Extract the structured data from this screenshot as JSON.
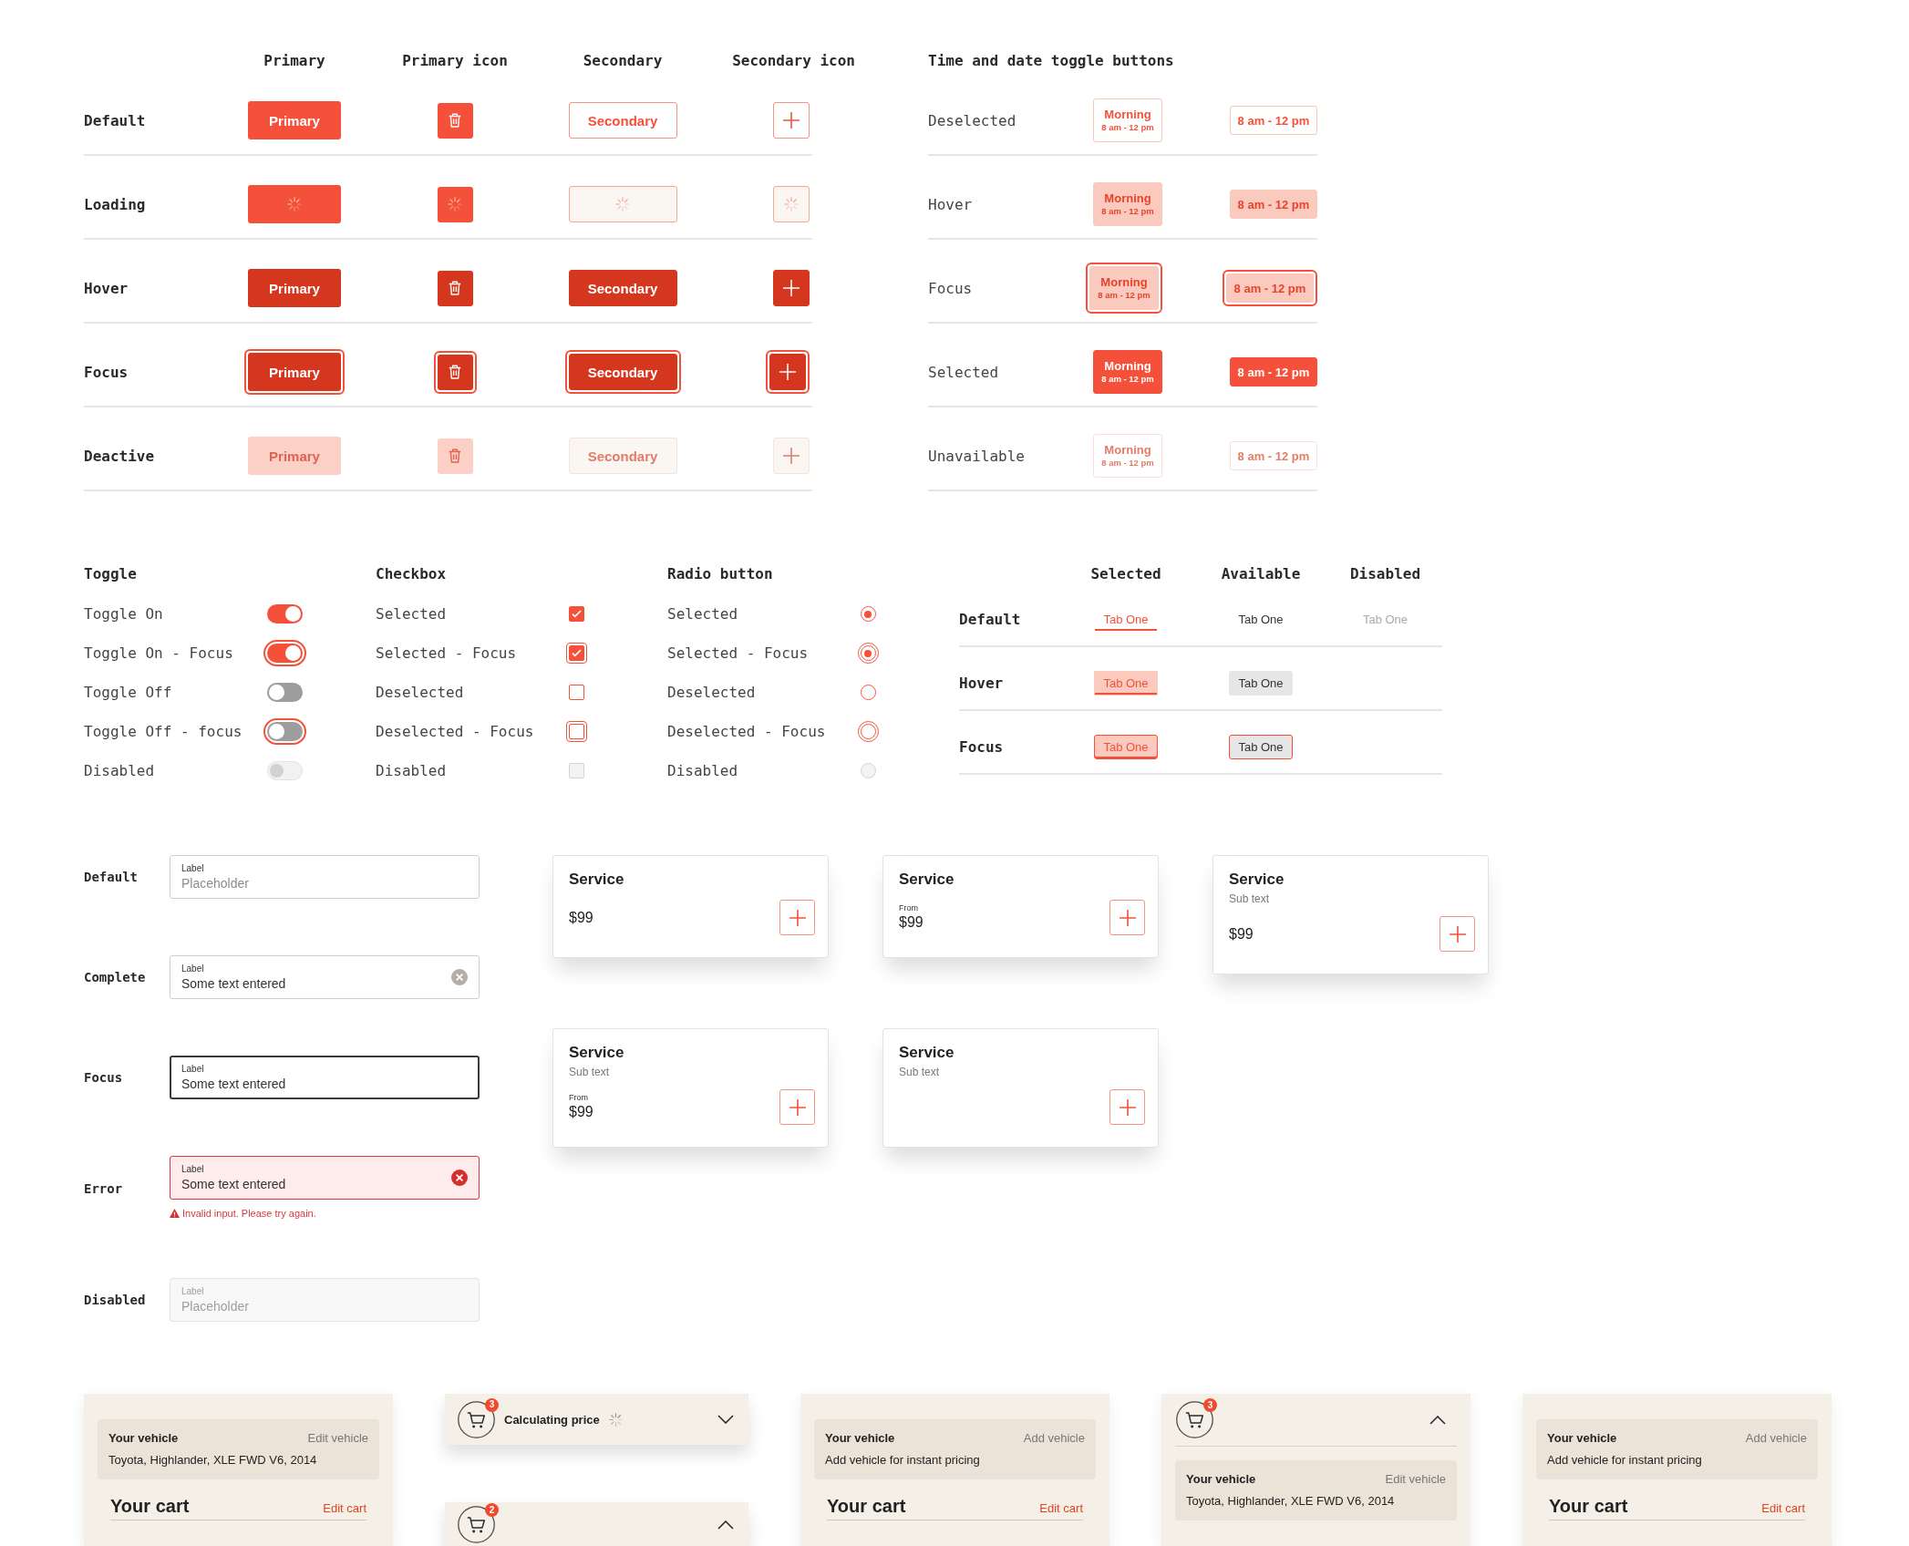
{
  "button_states": {
    "columns": [
      "Primary",
      "Primary icon",
      "Secondary",
      "Secondary icon"
    ],
    "rows": [
      {
        "label": "Default",
        "kind": "default",
        "primary": "Primary",
        "secondary": "Secondary"
      },
      {
        "label": "Loading",
        "kind": "loading"
      },
      {
        "label": "Hover",
        "kind": "hover",
        "primary": "Primary",
        "secondary": "Secondary"
      },
      {
        "label": "Focus",
        "kind": "focus",
        "primary": "Primary",
        "secondary": "Secondary"
      },
      {
        "label": "Deactive",
        "kind": "disabled",
        "primary": "Primary",
        "secondary": "Secondary"
      }
    ]
  },
  "time_toggles": {
    "title": "Time and date toggle buttons",
    "rows": [
      {
        "label": "Deselected",
        "kind": "deselected",
        "slot_title": "Morning",
        "slot_time": "8 am - 12 pm",
        "range": "8 am - 12 pm"
      },
      {
        "label": "Hover",
        "kind": "hover",
        "slot_title": "Morning",
        "slot_time": "8 am - 12 pm",
        "range": "8 am - 12 pm"
      },
      {
        "label": "Focus",
        "kind": "focus",
        "slot_title": "Morning",
        "slot_time": "8 am - 12 pm",
        "range": "8 am - 12 pm"
      },
      {
        "label": "Selected",
        "kind": "selected",
        "slot_title": "Morning",
        "slot_time": "8 am - 12 pm",
        "range": "8 am - 12 pm"
      },
      {
        "label": "Unavailable",
        "kind": "unavailable",
        "slot_title": "Morning",
        "slot_time": "8 am - 12 pm",
        "range": "8 am - 12 pm"
      }
    ]
  },
  "toggles": {
    "title": "Toggle",
    "items": [
      {
        "label": "Toggle On",
        "on": true,
        "focus": false,
        "disabled": false
      },
      {
        "label": "Toggle On - Focus",
        "on": true,
        "focus": true,
        "disabled": false
      },
      {
        "label": "Toggle Off",
        "on": false,
        "focus": false,
        "disabled": false
      },
      {
        "label": "Toggle Off - focus",
        "on": false,
        "focus": true,
        "disabled": false
      },
      {
        "label": "Disabled",
        "on": false,
        "focus": false,
        "disabled": true
      }
    ]
  },
  "checkboxes": {
    "title": "Checkbox",
    "items": [
      {
        "label": "Selected",
        "checked": true,
        "focus": false,
        "disabled": false
      },
      {
        "label": "Selected - Focus",
        "checked": true,
        "focus": true,
        "disabled": false
      },
      {
        "label": "Deselected",
        "checked": false,
        "focus": false,
        "disabled": false
      },
      {
        "label": "Deselected - Focus",
        "checked": false,
        "focus": true,
        "disabled": false
      },
      {
        "label": "Disabled",
        "checked": false,
        "focus": false,
        "disabled": true
      }
    ]
  },
  "radios": {
    "title": "Radio button",
    "items": [
      {
        "label": "Selected",
        "selected": true,
        "focus": false,
        "disabled": false
      },
      {
        "label": "Selected - Focus",
        "selected": true,
        "focus": true,
        "disabled": false
      },
      {
        "label": "Deselected",
        "selected": false,
        "focus": false,
        "disabled": false
      },
      {
        "label": "Deselected - Focus",
        "selected": false,
        "focus": true,
        "disabled": false
      },
      {
        "label": "Disabled",
        "selected": false,
        "focus": false,
        "disabled": true
      }
    ]
  },
  "tab_states": {
    "columns": [
      "Selected",
      "Available",
      "Disabled"
    ],
    "rows": [
      {
        "label": "Default",
        "kind": "default",
        "tabs": [
          {
            "label": "Tab One",
            "selected": true,
            "disabled": false
          },
          {
            "label": "Tab One",
            "selected": false,
            "disabled": false
          },
          {
            "label": "Tab One",
            "selected": false,
            "disabled": true
          }
        ]
      },
      {
        "label": "Hover",
        "kind": "hover",
        "tabs": [
          {
            "label": "Tab One",
            "selected": true,
            "disabled": false
          },
          {
            "label": "Tab One",
            "selected": false,
            "disabled": false
          }
        ]
      },
      {
        "label": "Focus",
        "kind": "focus",
        "tabs": [
          {
            "label": "Tab One",
            "selected": true,
            "disabled": false
          },
          {
            "label": "Tab One",
            "selected": false,
            "disabled": false
          }
        ]
      }
    ]
  },
  "text_fields": [
    {
      "state": "Default",
      "kind": "default",
      "label": "Label",
      "placeholder": "Placeholder"
    },
    {
      "state": "Complete",
      "kind": "complete",
      "label": "Label",
      "value": "Some text entered"
    },
    {
      "state": "Focus",
      "kind": "focus",
      "label": "Label",
      "value": "Some text entered"
    },
    {
      "state": "Error",
      "kind": "error",
      "label": "Label",
      "value": "Some text entered",
      "error": "Invalid input. Please try again."
    },
    {
      "state": "Disabled",
      "kind": "disabled",
      "label": "Label",
      "placeholder": "Placeholder"
    }
  ],
  "service_cards": [
    {
      "title": "Service",
      "price": "$99"
    },
    {
      "title": "Service",
      "price_caption": "From",
      "price": "$99"
    },
    {
      "title": "Service",
      "subtitle": "Sub text",
      "price": "$99"
    },
    {
      "title": "Service",
      "subtitle": "Sub text",
      "price_caption": "From",
      "price": "$99"
    },
    {
      "title": "Service",
      "subtitle": "Sub text"
    }
  ],
  "cart_panels": [
    {
      "kind": "cart",
      "vehicle": {
        "title": "Your vehicle",
        "action": "Edit vehicle",
        "text": "Toyota, Highlander, XLE FWD V6, 2014"
      },
      "cart_title": "Your cart",
      "cart_action": "Edit cart"
    },
    {
      "kind": "bars",
      "bars": [
        {
          "badge": "3",
          "text": "Calculating price",
          "loading": true,
          "expanded": false
        },
        {
          "badge": "2",
          "loading": false,
          "expanded": true
        }
      ]
    },
    {
      "kind": "cart",
      "vehicle": {
        "title": "Your vehicle",
        "action": "Add vehicle",
        "text": "Add vehicle for instant pricing"
      },
      "cart_title": "Your cart",
      "cart_action": "Edit cart"
    },
    {
      "kind": "header",
      "badge": "3",
      "expanded": true,
      "vehicle": {
        "title": "Your vehicle",
        "action": "Edit vehicle",
        "text": "Toyota, Highlander, XLE FWD V6, 2014"
      }
    },
    {
      "kind": "cart",
      "vehicle": {
        "title": "Your vehicle",
        "action": "Add vehicle",
        "text": "Add vehicle for instant pricing"
      },
      "cart_title": "Your cart",
      "cart_action": "Edit cart"
    }
  ]
}
